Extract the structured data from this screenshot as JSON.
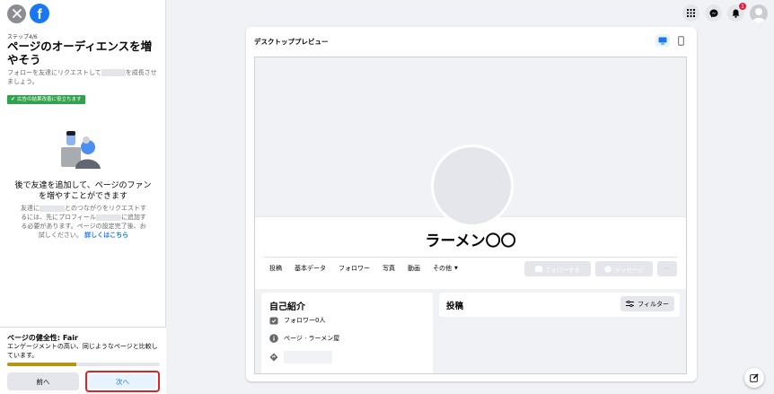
{
  "left_panel": {
    "step": "ステップ4/6",
    "title": "ページのオーディエンスを増やそう",
    "description_1": "フォローを友達にリクエストして",
    "description_2": "を成長させましょう。",
    "badge": "広告の結果改善に役立ちます",
    "info_heading": "後で友達を追加して、ページのファンを増やすことができます",
    "info_1": "友達に",
    "info_2": "とのつながりをリクエストするには、先にプロフィール",
    "info_3": "に追加する必要があります。ページの設定完了後、お試しください。",
    "info_link": "詳しくはこちら",
    "health_title": "ページの健全性: Fair",
    "health_desc": "エンゲージメントの高い、同じようなページと比較しています。",
    "health_progress": 0.45,
    "prev_button": "前へ",
    "next_button": "次へ"
  },
  "topbar": {
    "notification_count": "1"
  },
  "preview": {
    "title": "デスクトッププレビュー",
    "page_name": "ラーメン〇〇",
    "tabs": [
      "投稿",
      "基本データ",
      "フォロワー",
      "写真",
      "動画",
      "その他"
    ],
    "follow_button": "フォローする",
    "message_button": "メッセージ",
    "more_button": "···",
    "intro_title": "自己紹介",
    "followers": "フォロワー0人",
    "page_category": "ページ · ラーメン屋",
    "posts_title": "投稿",
    "filter_button": "フィルター"
  },
  "colors": {
    "accent": "#1877f2",
    "badge": "#31a24c",
    "health_bar": "#b59416",
    "highlight": "#e02424"
  }
}
